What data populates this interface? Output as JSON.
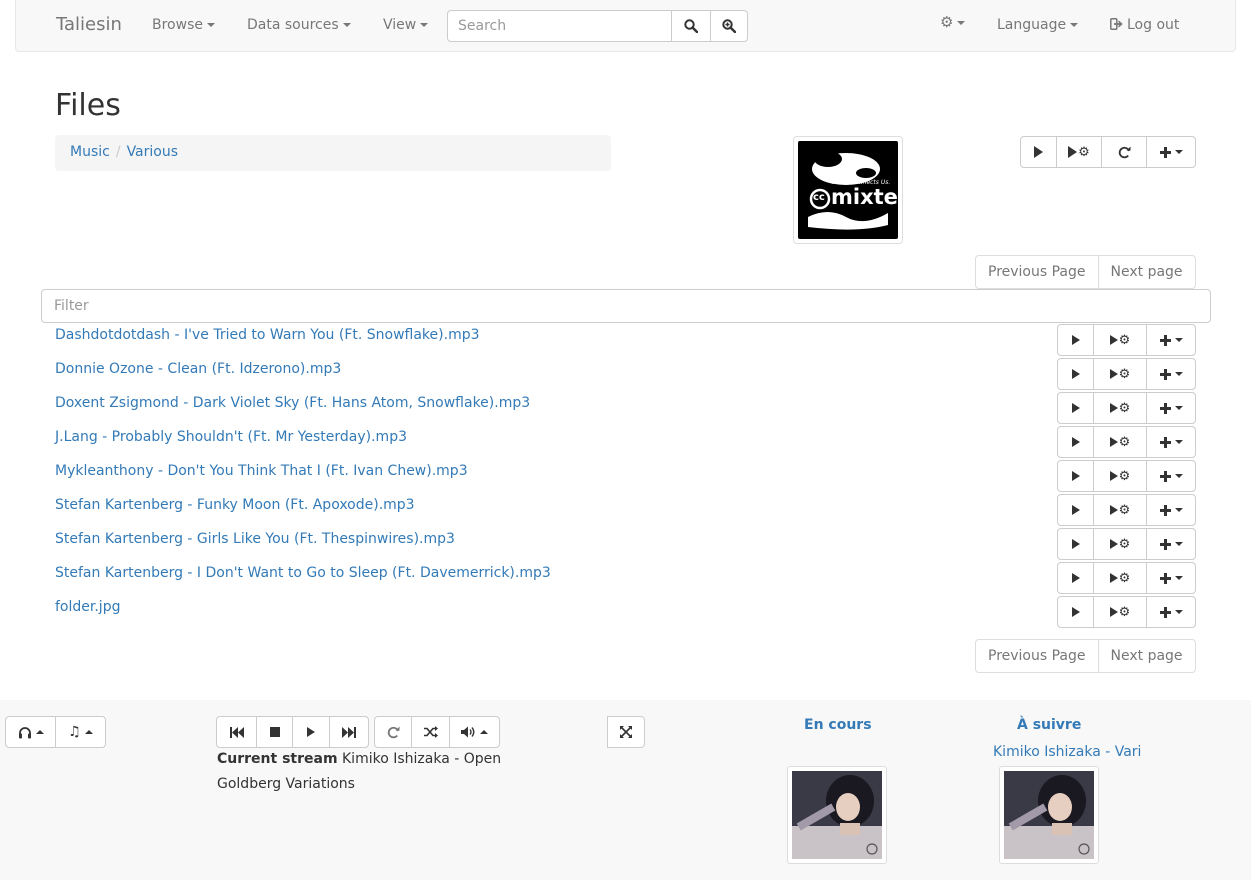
{
  "navbar": {
    "brand": "Taliesin",
    "browse": "Browse",
    "data_sources": "Data sources",
    "view": "View",
    "search_placeholder": "Search",
    "language": "Language",
    "logout": "Log out"
  },
  "page": {
    "title": "Files",
    "breadcrumb": [
      "Music",
      "Various"
    ],
    "cover_logo": {
      "brand": "mixter",
      "tagline": "Music Connects Us.",
      "cc": "cc"
    },
    "prev_page": "Previous Page",
    "next_page": "Next page",
    "filter_placeholder": "Filter"
  },
  "files": [
    "Dashdotdotdash - I've Tried to Warn You (Ft. Snowflake).mp3",
    "Donnie Ozone - Clean (Ft. Idzerono).mp3",
    "Doxent Zsigmond - Dark Violet Sky (Ft. Hans Atom, Snowflake).mp3",
    "J.Lang - Probably Shouldn't (Ft. Mr Yesterday).mp3",
    "Mykleanthony - Don't You Think That I (Ft. Ivan Chew).mp3",
    "Stefan Kartenberg - Funky Moon (Ft. Apoxode).mp3",
    "Stefan Kartenberg - Girls Like You (Ft. Thespinwires).mp3",
    "Stefan Kartenberg - I Don't Want to Go to Sleep (Ft. Davemerrick).mp3",
    "folder.jpg"
  ],
  "player": {
    "current_stream_label": "Current stream",
    "current_stream_value": "Kimiko Ishizaka - Open Goldberg Variations",
    "now_playing_heading": "En cours",
    "up_next_heading": "À suivre",
    "up_next_title": "Kimiko Ishizaka - Variations"
  },
  "icons": {
    "search": "search-icon",
    "advanced_search": "zoom-in-icon",
    "settings": "gear-icon",
    "logout": "logout-icon",
    "play": "play-icon",
    "play_with_options": "play-settings-icon",
    "refresh": "refresh-icon",
    "add": "plus-icon",
    "headphones": "headphones-icon",
    "music": "music-icon",
    "previous": "step-backward-icon",
    "stop": "stop-icon",
    "next": "step-forward-icon",
    "repeat": "repeat-icon",
    "shuffle": "shuffle-icon",
    "volume": "volume-icon",
    "fullscreen": "fullscreen-icon"
  },
  "colors": {
    "link": "#337ab7",
    "navbar_bg": "#f8f8f8",
    "breadcrumb_bg": "#f5f5f5"
  }
}
